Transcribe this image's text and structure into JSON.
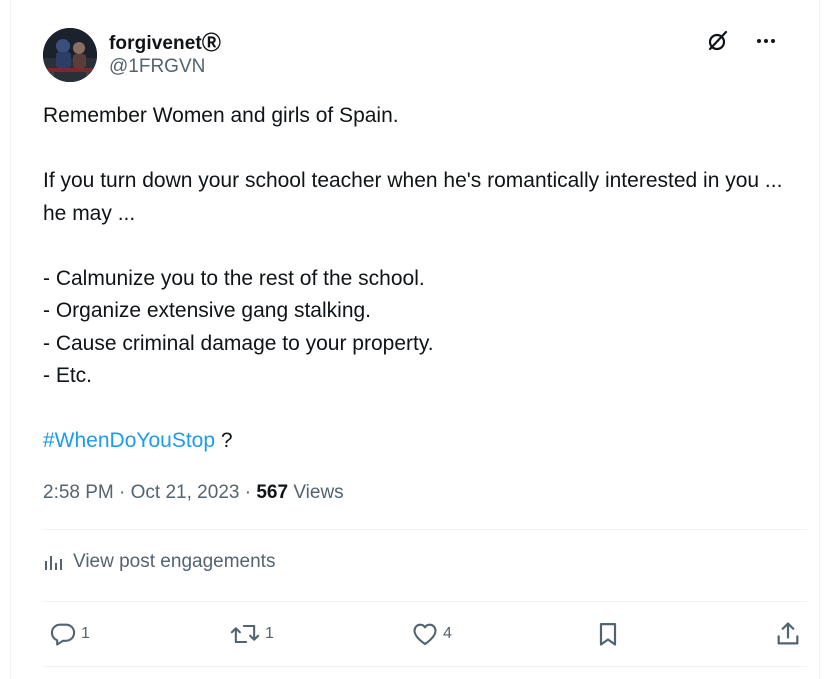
{
  "post": {
    "author": {
      "display_name": "forgivenetⓇ",
      "handle": "@1FRGVN"
    },
    "text": {
      "line1": "Remember Women and girls of Spain.",
      "para2": "If you turn down your school teacher when he's romantically interested in you ... he may ...",
      "list": [
        "- Calmunize you to the rest of the school.",
        "- Organize extensive gang stalking.",
        "- Cause criminal damage to your property.",
        "- Etc."
      ],
      "hashtag": "#WhenDoYouStop",
      "hashtag_suffix": " ?"
    },
    "meta": {
      "time": "2:58 PM",
      "separator": " · ",
      "date": "Oct 21, 2023",
      "views_count": "567",
      "views_label": " Views"
    },
    "engagements_label": "View post engagements",
    "actions": {
      "replies": "1",
      "reposts": "1",
      "likes": "4"
    }
  },
  "icons": {
    "top": [
      "grok-slash-icon",
      "more-icon"
    ],
    "actions": [
      "reply-icon",
      "repost-icon",
      "like-icon",
      "bookmark-icon",
      "share-icon"
    ],
    "engagements": "analytics-icon"
  },
  "colors": {
    "text": "#0f1419",
    "secondary": "#536471",
    "accent": "#1d9bf0",
    "divider": "#eff3f4"
  }
}
